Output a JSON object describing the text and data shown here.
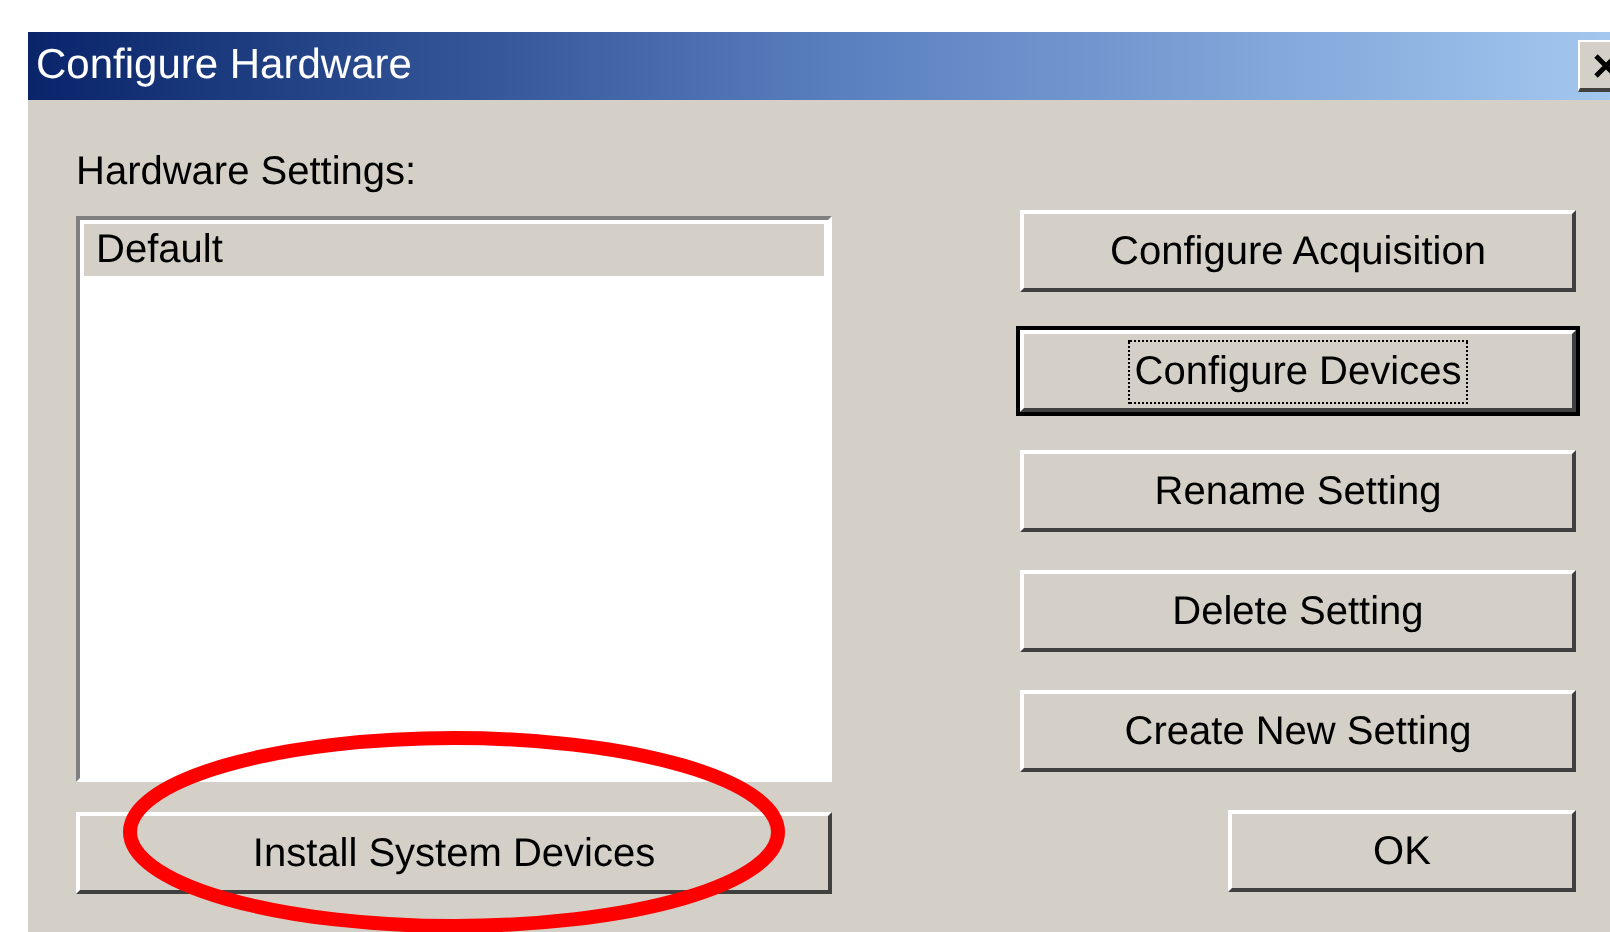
{
  "window": {
    "title": "Configure Hardware"
  },
  "settings_label": "Hardware Settings:",
  "settings_list": [
    {
      "label": "Default",
      "selected": true
    }
  ],
  "install_button": {
    "label": "Install System Devices",
    "highlighted": true
  },
  "action_buttons": [
    {
      "label": "Configure Acquisition",
      "focused": false
    },
    {
      "label": "Configure Devices",
      "focused": true
    },
    {
      "label": "Rename Setting",
      "focused": false
    },
    {
      "label": "Delete Setting",
      "focused": false
    },
    {
      "label": "Create New Setting",
      "focused": false
    }
  ],
  "ok_button": {
    "label": "OK",
    "focused": false
  }
}
